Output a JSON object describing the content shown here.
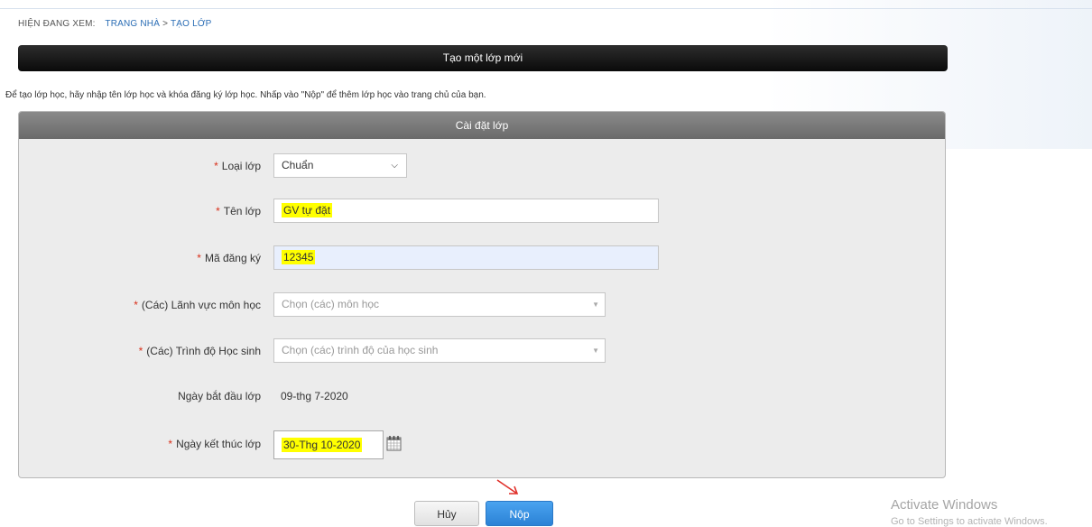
{
  "breadcrumb": {
    "lead": "HIỆN ĐANG XEM:",
    "home": "TRANG NHÀ",
    "separator": ">",
    "current": "TẠO LỚP"
  },
  "title": "Tạo một lớp mới",
  "intro": "Để tạo lớp học, hãy nhập tên lớp học và khóa đăng ký lớp học. Nhấp vào \"Nộp\" để thêm lớp học vào trang chủ của bạn.",
  "panel": {
    "heading": "Cài đặt lớp",
    "required_mark": "*",
    "fields": {
      "class_type": {
        "label": "Loại lớp",
        "value": "Chuẩn"
      },
      "class_name": {
        "label": "Tên lớp",
        "value": "GV tự đặt"
      },
      "reg_code": {
        "label": "Mã đăng ký",
        "value": "12345"
      },
      "subjects": {
        "label": "(Các) Lãnh vực môn học",
        "placeholder": "Chọn (các) môn học"
      },
      "levels": {
        "label": "(Các) Trình độ Học sinh",
        "placeholder": "Chọn (các) trình độ của học sinh"
      },
      "start_date": {
        "label": "Ngày bắt đầu lớp",
        "value": "09-thg 7-2020"
      },
      "end_date": {
        "label": "Ngày kết thúc lớp",
        "value": "30-Thg 10-2020"
      }
    }
  },
  "buttons": {
    "cancel": "Hủy",
    "submit": "Nộp"
  },
  "watermark": {
    "line1": "Activate Windows",
    "line2": "Go to Settings to activate Windows."
  },
  "colors": {
    "title_bar": "#111111",
    "panel_head": "#777777",
    "highlight": "#ffff00",
    "required": "#d9301a",
    "submit": "#3592e3",
    "annotation_arrow": "#e0302a"
  },
  "icons": {
    "dropdown": "chevron-down-icon",
    "calendar": "calendar-icon",
    "annotation": "red-arrow-icon"
  }
}
